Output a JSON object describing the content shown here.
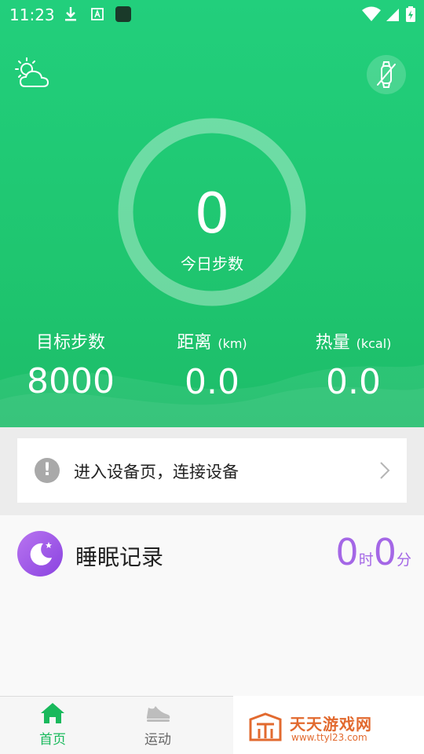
{
  "statusbar": {
    "time": "11:23"
  },
  "hero": {
    "steps_value": "0",
    "steps_label": "今日步数",
    "stats": [
      {
        "label": "目标步数",
        "unit": "",
        "value": "8000"
      },
      {
        "label": "距离",
        "unit": "(km)",
        "value": "0.0"
      },
      {
        "label": "热量",
        "unit": "(kcal)",
        "value": "0.0"
      }
    ]
  },
  "connect": {
    "text": "进入设备页，连接设备"
  },
  "sleep": {
    "title": "睡眠记录",
    "hours": "0",
    "hours_unit": "时",
    "minutes": "0",
    "minutes_unit": "分"
  },
  "tabbar": {
    "tabs": [
      {
        "label": "首页",
        "active": true
      },
      {
        "label": "运动",
        "active": false
      }
    ]
  },
  "watermark": {
    "title": "天天游戏网",
    "url": "www.ttyl23.com"
  },
  "colors": {
    "primary_green": "#22cf7c",
    "accent_purple": "#a467e6",
    "tab_active": "#19b95c",
    "watermark_orange": "#e26a2f"
  },
  "icons": [
    "download-icon",
    "a-notification-icon",
    "app-square-icon",
    "wifi-icon",
    "signal-icon",
    "battery-icon",
    "weather-icon",
    "watch-disconnected-icon",
    "warning-icon",
    "chevron-right-icon",
    "moon-icon",
    "home-icon",
    "shoe-icon",
    "watermark-logo-icon"
  ]
}
